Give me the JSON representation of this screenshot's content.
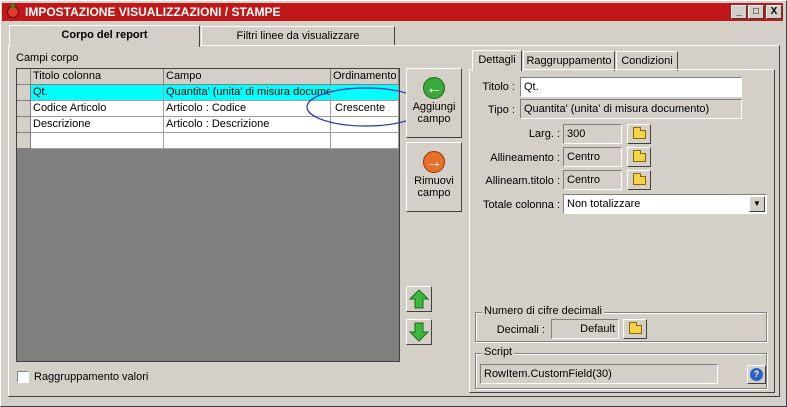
{
  "window": {
    "title": "IMPOSTAZIONE VISUALIZZAZIONI / STAMPE",
    "minimize": "_",
    "maximize": "□",
    "close": "X"
  },
  "main_tabs": [
    "Corpo del report",
    "Filtri linee da visualizzare"
  ],
  "campi_corpo": {
    "label": "Campi corpo",
    "columns": [
      "Titolo colonna",
      "Campo",
      "Ordinamento"
    ],
    "rows": [
      {
        "titolo": "Qt.",
        "campo": "Quantita' (unita' di misura documento)",
        "ordinamento": ""
      },
      {
        "titolo": "Codice Articolo",
        "campo": "Articolo : Codice",
        "ordinamento": "Crescente"
      },
      {
        "titolo": "Descrizione",
        "campo": "Articolo : Descrizione",
        "ordinamento": ""
      },
      {
        "titolo": "",
        "campo": "",
        "ordinamento": ""
      }
    ]
  },
  "buttons": {
    "aggiungi": "Aggiungi campo",
    "rimuovi": "Rimuovi campo"
  },
  "raggruppamento_valori": "Raggruppamento valori",
  "detail_tabs": [
    "Dettagli",
    "Raggruppamento",
    "Condizioni"
  ],
  "dettagli": {
    "titolo_label": "Titolo :",
    "titolo_value": "Qt.",
    "tipo_label": "Tipo :",
    "tipo_value": "Quantita' (unita' di misura documento)",
    "larg_label": "Larg. :",
    "larg_value": "300",
    "allineamento_label": "Allineamento :",
    "allineamento_value": "Centro",
    "allineam_titolo_label": "Allineam.titolo :",
    "allineam_titolo_value": "Centro",
    "totale_label": "Totale colonna :",
    "totale_value": "Non totalizzare",
    "decimali_group": "Numero di cifre decimali",
    "decimali_label": "Decimali :",
    "decimali_value": "Default",
    "script_group": "Script",
    "script_value": "RowItem.CustomField(30)"
  },
  "colors": {
    "titlebar": "#c01818",
    "selection": "#00ffff",
    "highlight_ellipse": "#2030c0"
  }
}
